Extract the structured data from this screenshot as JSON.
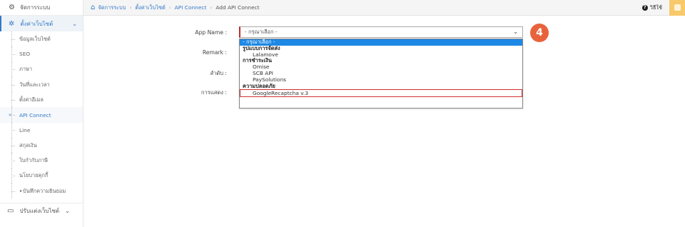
{
  "sidebar": {
    "top_label": "จัดการระบบ",
    "group_label": "ตั้งค่าเว็บไซต์",
    "items": [
      {
        "label": "ข้อมูลเว็บไซต์"
      },
      {
        "label": "SEO"
      },
      {
        "label": "ภาษา"
      },
      {
        "label": "วันที่และเวลา"
      },
      {
        "label": "ตั้งค่าอีเมล"
      },
      {
        "label": "API Connect"
      },
      {
        "label": "Line"
      },
      {
        "label": "สกุลเงิน"
      },
      {
        "label": "ใบกำกับภาษี"
      },
      {
        "label": "นโยบายคุกกี้"
      },
      {
        "label": "บันทึกความยินยอม"
      }
    ],
    "bottom_label": "ปรับแต่งเว็บไซต์"
  },
  "breadcrumb": {
    "items": [
      "จัดการระบบ",
      "ตั้งค่าเว็บไซต์",
      "API Connect"
    ],
    "current": "Add API Connect",
    "sep": "›"
  },
  "topbar": {
    "help_label": "วิธีใช้"
  },
  "form": {
    "app_name_label": "App Name :",
    "remark_label": "Remark :",
    "order_label": "ลำดับ :",
    "display_label": "การแสดง :",
    "app_name_value": "- กรุณาเลือก -"
  },
  "dropdown": {
    "options": [
      {
        "label": "- กรุณาเลือก -",
        "kind": "selected"
      },
      {
        "label": "รูปแบบการจัดส่ง",
        "kind": "group"
      },
      {
        "label": "Lalamove",
        "kind": "child"
      },
      {
        "label": "การชำระเงิน",
        "kind": "group"
      },
      {
        "label": "Omise",
        "kind": "child"
      },
      {
        "label": "SCB API",
        "kind": "child"
      },
      {
        "label": "PaySolutions",
        "kind": "child"
      },
      {
        "label": "ความปลอดภัย",
        "kind": "group"
      },
      {
        "label": "GoogleRecaptcha v.3",
        "kind": "child highlight"
      }
    ]
  },
  "step_badge": "4",
  "colors": {
    "accent": "#3579c8",
    "badge": "#e8633c",
    "highlight": "#d32f2f",
    "selected": "#1e88e5"
  }
}
